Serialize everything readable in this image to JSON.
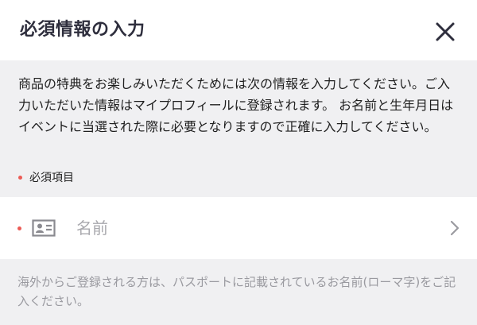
{
  "header": {
    "title": "必須情報の入力",
    "close_icon": "close-icon"
  },
  "intro": {
    "text": "商品の特典をお楽しみいただくためには次の情報を入力してください。ご入力いただいた情報はマイプロフィールに登録されます。 お名前と生年月日はイベントに当選された際に必要となりますので正確に入力してください。",
    "required_label": "必須項目"
  },
  "form": {
    "name_field": {
      "label": "名前",
      "icon": "id-card-icon",
      "trailing_icon": "chevron-right-icon",
      "required": true
    }
  },
  "footnote": "海外からご登録される方は、パスポートに記載されているお名前(ローマ字)をご記入ください。",
  "colors": {
    "required_dot": "#ec5b55",
    "header_bg": "#ffffff",
    "page_bg": "#f0f0f2",
    "title_text": "#2e2e3d",
    "placeholder_text": "#a9a9ae",
    "hint_text": "#9a9aa0"
  }
}
